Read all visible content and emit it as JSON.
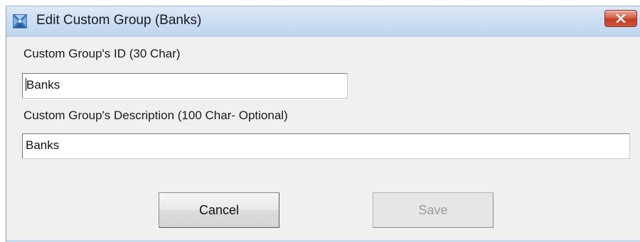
{
  "window": {
    "title": "Edit Custom Group (Banks)"
  },
  "icons": {
    "app": "app-icon",
    "close": "close-icon"
  },
  "form": {
    "id_label": "Custom Group's ID (30 Char)",
    "id_value": "Banks",
    "description_label": "Custom Group's Description (100 Char- Optional)",
    "description_value": "Banks"
  },
  "buttons": {
    "cancel_label": "Cancel",
    "save_label": "Save",
    "save_enabled": false
  },
  "colors": {
    "titlebar": "#cddff3",
    "close_button": "#c43b22",
    "dialog_background": "#f0f0f0"
  }
}
